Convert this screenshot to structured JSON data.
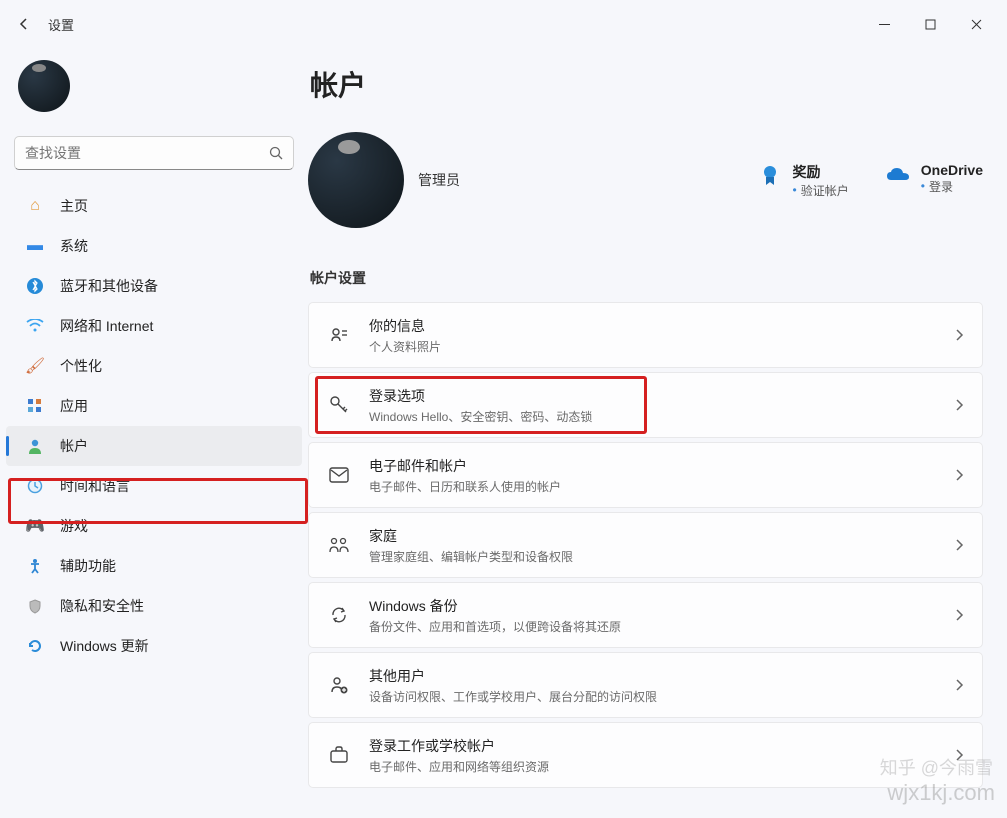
{
  "window": {
    "title": "设置"
  },
  "search": {
    "placeholder": "查找设置"
  },
  "nav_items": [
    {
      "key": "home",
      "label": "主页"
    },
    {
      "key": "system",
      "label": "系统"
    },
    {
      "key": "bluetooth",
      "label": "蓝牙和其他设备"
    },
    {
      "key": "network",
      "label": "网络和 Internet"
    },
    {
      "key": "personalization",
      "label": "个性化"
    },
    {
      "key": "apps",
      "label": "应用"
    },
    {
      "key": "accounts",
      "label": "帐户"
    },
    {
      "key": "time",
      "label": "时间和语言"
    },
    {
      "key": "gaming",
      "label": "游戏"
    },
    {
      "key": "accessibility",
      "label": "辅助功能"
    },
    {
      "key": "privacy",
      "label": "隐私和安全性"
    },
    {
      "key": "update",
      "label": "Windows 更新"
    }
  ],
  "page": {
    "title": "帐户",
    "role": "管理员",
    "section_title": "帐户设置"
  },
  "tiles": [
    {
      "key": "rewards",
      "title": "奖励",
      "sub": "验证帐户"
    },
    {
      "key": "onedrive",
      "title": "OneDrive",
      "sub": "登录"
    }
  ],
  "cards": [
    {
      "key": "your-info",
      "title": "你的信息",
      "sub": "个人资料照片"
    },
    {
      "key": "signin",
      "title": "登录选项",
      "sub": "Windows Hello、安全密钥、密码、动态锁"
    },
    {
      "key": "email",
      "title": "电子邮件和帐户",
      "sub": "电子邮件、日历和联系人使用的帐户"
    },
    {
      "key": "family",
      "title": "家庭",
      "sub": "管理家庭组、编辑帐户类型和设备权限"
    },
    {
      "key": "backup",
      "title": "Windows 备份",
      "sub": "备份文件、应用和首选项，以便跨设备将其还原"
    },
    {
      "key": "other-users",
      "title": "其他用户",
      "sub": "设备访问权限、工作或学校用户、展台分配的访问权限"
    },
    {
      "key": "work-school",
      "title": "登录工作或学校帐户",
      "sub": "电子邮件、应用和网络等组织资源"
    }
  ],
  "watermark": "wjx1kj.com",
  "watermark2": "知乎 @今雨雪"
}
